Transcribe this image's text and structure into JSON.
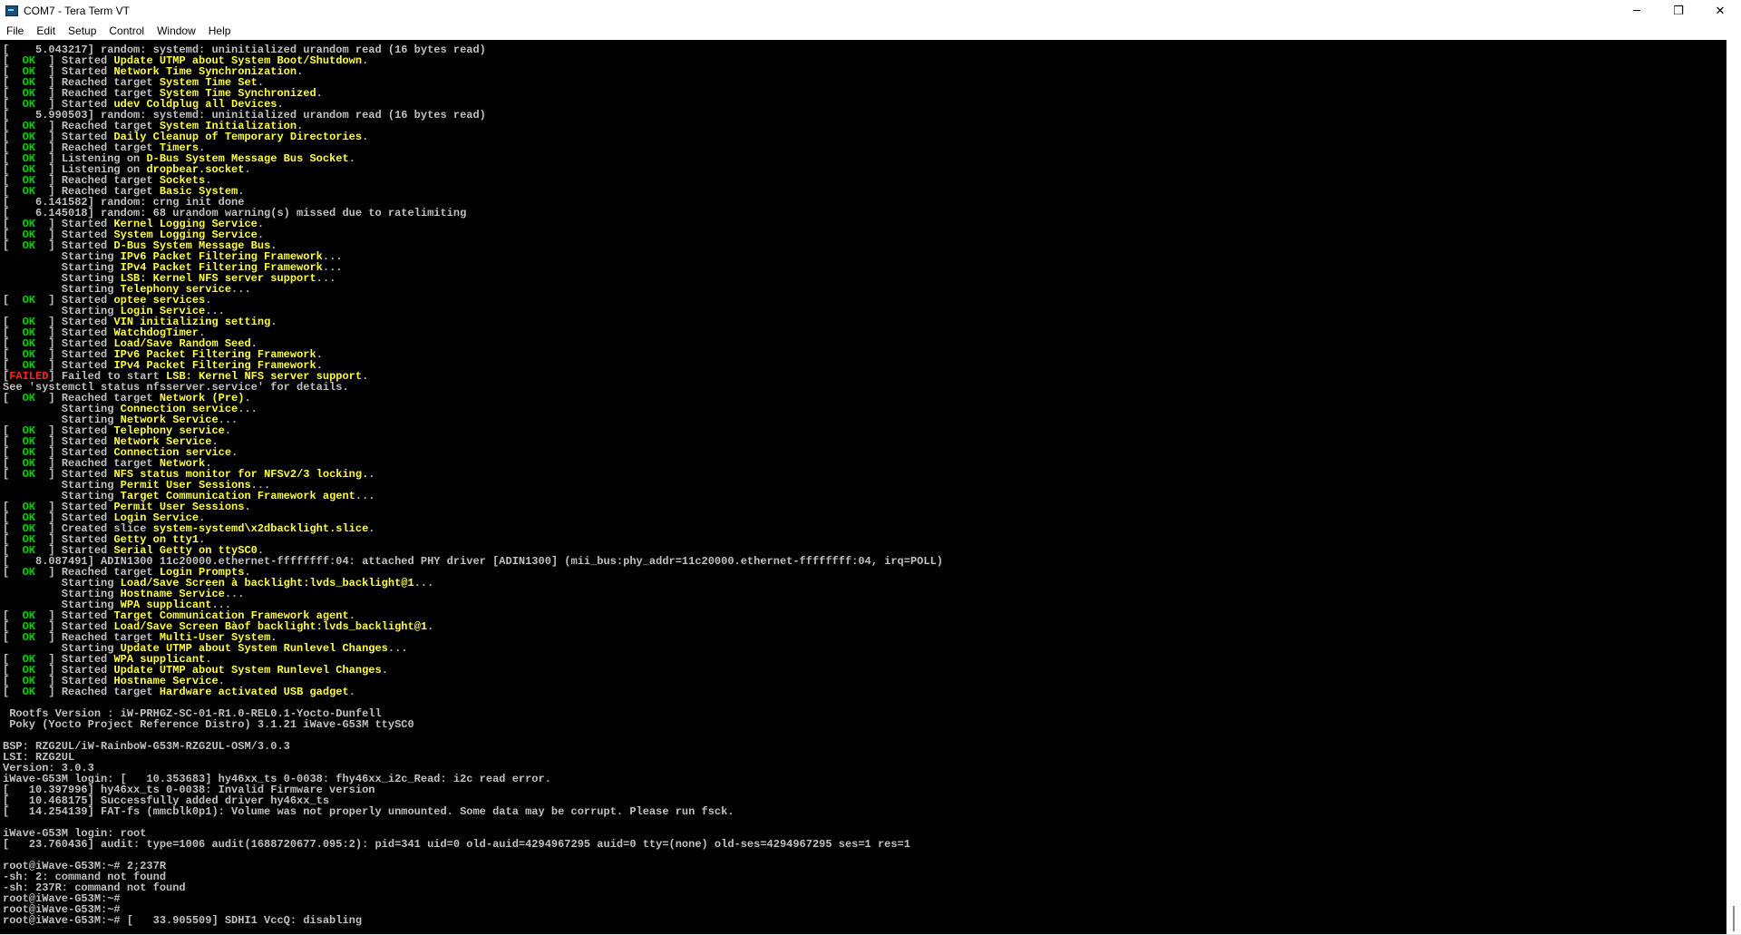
{
  "window": {
    "title": "COM7 - Tera Term VT",
    "controls": {
      "minimize": "─",
      "maximize": "❐",
      "close": "✕"
    }
  },
  "menu": [
    "File",
    "Edit",
    "Setup",
    "Control",
    "Window",
    "Help"
  ],
  "colors": {
    "background": "#000000",
    "text": "#c0c0c0",
    "ok": "#00d000",
    "failed": "#ff2020",
    "highlight": "#ffff40"
  },
  "terminal_lines": [
    {
      "s": "[",
      "x": "    5.043217] random: systemd: uninitialized urandom read (16 bytes read)"
    },
    {
      "s": "ok",
      "a": "] Started ",
      "h": "Update UTMP about System Boot/Shutdown",
      "z": "."
    },
    {
      "s": "ok",
      "a": "] Started ",
      "h": "Network Time Synchronization",
      "z": "."
    },
    {
      "s": "ok",
      "a": "] Reached target ",
      "h": "System Time Set",
      "z": "."
    },
    {
      "s": "ok",
      "a": "] Reached target ",
      "h": "System Time Synchronized",
      "z": "."
    },
    {
      "s": "ok",
      "a": "] Started ",
      "h": "udev Coldplug all Devices",
      "z": "."
    },
    {
      "s": "[",
      "x": "    5.990503] random: systemd: uninitialized urandom read (16 bytes read)"
    },
    {
      "s": "ok",
      "a": "] Reached target ",
      "h": "System Initialization",
      "z": "."
    },
    {
      "s": "ok",
      "a": "] Started ",
      "h": "Daily Cleanup of Temporary Directories",
      "z": "."
    },
    {
      "s": "ok",
      "a": "] Reached target ",
      "h": "Timers",
      "z": "."
    },
    {
      "s": "ok",
      "a": "] Listening on ",
      "h": "D-Bus System Message Bus Socket",
      "z": "."
    },
    {
      "s": "ok",
      "a": "] Listening on ",
      "h": "dropbear.socket",
      "z": "."
    },
    {
      "s": "ok",
      "a": "] Reached target ",
      "h": "Sockets",
      "z": "."
    },
    {
      "s": "ok",
      "a": "] Reached target ",
      "h": "Basic System",
      "z": "."
    },
    {
      "s": "[",
      "x": "    6.141582] random: crng init done"
    },
    {
      "s": "[",
      "x": "    6.145018] random: 68 urandom warning(s) missed due to ratelimiting"
    },
    {
      "s": "ok",
      "a": "] Started ",
      "h": "Kernel Logging Service",
      "z": "."
    },
    {
      "s": "ok",
      "a": "] Started ",
      "h": "System Logging Service",
      "z": "."
    },
    {
      "s": "ok",
      "a": "] Started ",
      "h": "D-Bus System Message Bus",
      "z": "."
    },
    {
      "s": "sp",
      "a": "Starting ",
      "h": "IPv6 Packet Filtering Framework",
      "z": "..."
    },
    {
      "s": "sp",
      "a": "Starting ",
      "h": "IPv4 Packet Filtering Framework",
      "z": "..."
    },
    {
      "s": "sp",
      "a": "Starting ",
      "h": "LSB: Kernel NFS server support",
      "z": "..."
    },
    {
      "s": "sp",
      "a": "Starting ",
      "h": "Telephony service",
      "z": "..."
    },
    {
      "s": "ok",
      "a": "] Started ",
      "h": "optee services",
      "z": "."
    },
    {
      "s": "sp",
      "a": "Starting ",
      "h": "Login Service",
      "z": "..."
    },
    {
      "s": "ok",
      "a": "] Started ",
      "h": "VIN initializing setting",
      "z": "."
    },
    {
      "s": "ok",
      "a": "] Started ",
      "h": "WatchdogTimer",
      "z": "."
    },
    {
      "s": "ok",
      "a": "] Started ",
      "h": "Load/Save Random Seed",
      "z": "."
    },
    {
      "s": "ok",
      "a": "] Started ",
      "h": "IPv6 Packet Filtering Framework",
      "z": "."
    },
    {
      "s": "ok",
      "a": "] Started ",
      "h": "IPv4 Packet Filtering Framework",
      "z": "."
    },
    {
      "s": "failed",
      "a": "] Failed to start ",
      "h": "LSB: Kernel NFS server support",
      "z": "."
    },
    {
      "s": "",
      "x": "See 'systemctl status nfsserver.service' for details."
    },
    {
      "s": "ok",
      "a": "] Reached target ",
      "h": "Network (Pre)",
      "z": "."
    },
    {
      "s": "sp",
      "a": "Starting ",
      "h": "Connection service",
      "z": "..."
    },
    {
      "s": "sp",
      "a": "Starting ",
      "h": "Network Service",
      "z": "..."
    },
    {
      "s": "ok",
      "a": "] Started ",
      "h": "Telephony service",
      "z": "."
    },
    {
      "s": "ok",
      "a": "] Started ",
      "h": "Network Service",
      "z": "."
    },
    {
      "s": "ok",
      "a": "] Started ",
      "h": "Connection service",
      "z": "."
    },
    {
      "s": "ok",
      "a": "] Reached target ",
      "h": "Network",
      "z": "."
    },
    {
      "s": "ok",
      "a": "] Started ",
      "h": "NFS status monitor for NFSv2/3 locking.",
      "z": "."
    },
    {
      "s": "sp",
      "a": "Starting ",
      "h": "Permit User Sessions",
      "z": "..."
    },
    {
      "s": "sp",
      "a": "Starting ",
      "h": "Target Communication Framework agent",
      "z": "..."
    },
    {
      "s": "ok",
      "a": "] Started ",
      "h": "Permit User Sessions",
      "z": "."
    },
    {
      "s": "ok",
      "a": "] Started ",
      "h": "Login Service",
      "z": "."
    },
    {
      "s": "ok",
      "a": "] Created slice ",
      "h": "system-systemd\\x2dbacklight.slice",
      "z": "."
    },
    {
      "s": "ok",
      "a": "] Started ",
      "h": "Getty on tty1",
      "z": "."
    },
    {
      "s": "ok",
      "a": "] Started ",
      "h": "Serial Getty on ttySC0",
      "z": "."
    },
    {
      "s": "[",
      "x": "    8.087491] ADIN1300 11c20000.ethernet-ffffffff:04: attached PHY driver [ADIN1300] (mii_bus:phy_addr=11c20000.ethernet-ffffffff:04, irq=POLL)"
    },
    {
      "s": "ok",
      "a": "] Reached target ",
      "h": "Login Prompts",
      "z": "."
    },
    {
      "s": "sp",
      "a": "Starting ",
      "h": "Load/Save Screen à backlight:lvds_backlight@1",
      "z": "..."
    },
    {
      "s": "sp",
      "a": "Starting ",
      "h": "Hostname Service",
      "z": "..."
    },
    {
      "s": "sp",
      "a": "Starting ",
      "h": "WPA supplicant",
      "z": "..."
    },
    {
      "s": "ok",
      "a": "] Started ",
      "h": "Target Communication Framework agent",
      "z": "."
    },
    {
      "s": "ok",
      "a": "] Started ",
      "h": "Load/Save Screen Bàof backlight:lvds_backlight@1",
      "z": "."
    },
    {
      "s": "ok",
      "a": "] Reached target ",
      "h": "Multi-User System",
      "z": "."
    },
    {
      "s": "sp",
      "a": "Starting ",
      "h": "Update UTMP about System Runlevel Changes",
      "z": "..."
    },
    {
      "s": "ok",
      "a": "] Started ",
      "h": "WPA supplicant",
      "z": "."
    },
    {
      "s": "ok",
      "a": "] Started ",
      "h": "Update UTMP about System Runlevel Changes",
      "z": "."
    },
    {
      "s": "ok",
      "a": "] Started ",
      "h": "Hostname Service",
      "z": "."
    },
    {
      "s": "ok",
      "a": "] Reached target ",
      "h": "Hardware activated USB gadget",
      "z": "."
    },
    {
      "s": "",
      "x": ""
    },
    {
      "s": "",
      "x": " Rootfs Version : iW-PRHGZ-SC-01-R1.0-REL0.1-Yocto-Dunfell"
    },
    {
      "s": "",
      "x": " Poky (Yocto Project Reference Distro) 3.1.21 iWave-G53M ttySC0"
    },
    {
      "s": "",
      "x": ""
    },
    {
      "s": "",
      "x": "BSP: RZG2UL/iW-RainboW-G53M-RZG2UL-OSM/3.0.3"
    },
    {
      "s": "",
      "x": "LSI: RZG2UL"
    },
    {
      "s": "",
      "x": "Version: 3.0.3"
    },
    {
      "s": "",
      "x": "iWave-G53M login: [   10.353683] hy46xx_ts 0-0038: fhy46xx_i2c_Read: i2c read error."
    },
    {
      "s": "",
      "x": "[   10.397996] hy46xx_ts 0-0038: Invalid Firmware version"
    },
    {
      "s": "",
      "x": "[   10.468175] Successfully added driver hy46xx_ts"
    },
    {
      "s": "",
      "x": "[   14.254139] FAT-fs (mmcblk0p1): Volume was not properly unmounted. Some data may be corrupt. Please run fsck."
    },
    {
      "s": "",
      "x": ""
    },
    {
      "s": "",
      "x": "iWave-G53M login: root"
    },
    {
      "s": "",
      "x": "[   23.760436] audit: type=1006 audit(1688720677.095:2): pid=341 uid=0 old-auid=4294967295 auid=0 tty=(none) old-ses=4294967295 ses=1 res=1"
    },
    {
      "s": "",
      "x": ""
    },
    {
      "s": "",
      "x": "root@iWave-G53M:~# 2;237R"
    },
    {
      "s": "",
      "x": "-sh: 2: command not found"
    },
    {
      "s": "",
      "x": "-sh: 237R: command not found"
    },
    {
      "s": "",
      "x": "root@iWave-G53M:~#"
    },
    {
      "s": "",
      "x": "root@iWave-G53M:~#"
    },
    {
      "s": "",
      "x": "root@iWave-G53M:~# [   33.905509] SDHI1 VccQ: disabling"
    }
  ]
}
